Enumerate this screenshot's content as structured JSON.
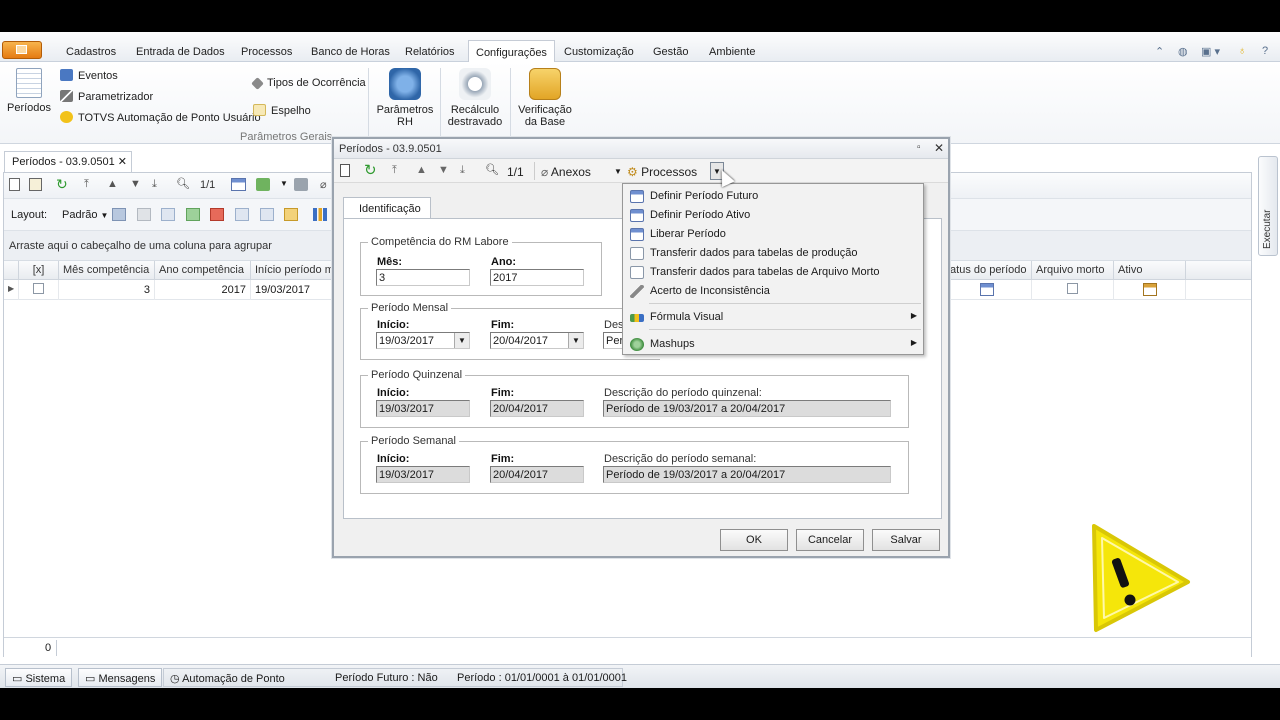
{
  "menubar": {
    "items": [
      "Cadastros",
      "Entrada de Dados",
      "Processos",
      "Banco de Horas",
      "Relatórios",
      "Configurações",
      "Customização",
      "Gestão",
      "Ambiente"
    ],
    "active": "Configurações"
  },
  "ribbon": {
    "periodos": "Períodos",
    "eventos": "Eventos",
    "parametrizador": "Parametrizador",
    "automacao": "TOTVS Automação de Ponto Usuário",
    "tipos_ocorrencia": "Tipos de Ocorrência",
    "espelho": "Espelho",
    "group_label": "Parâmetros Gerais",
    "parametros_rh_1": "Parâmetros",
    "parametros_rh_2": "RH",
    "recalculo_1": "Recálculo",
    "recalculo_2": "destravado",
    "verificacao_1": "Verificação",
    "verificacao_2": "da Base"
  },
  "doc_tab": {
    "title": "Períodos - 03.9.0501",
    "close": "✕"
  },
  "toolbar": {
    "page": "1/1"
  },
  "layoutbar": {
    "layout_label": "Layout:",
    "layout_value": "Padrão"
  },
  "groupbar": {
    "text": "Arraste aqui o cabeçalho de uma coluna para agrupar"
  },
  "grid": {
    "headers": {
      "select": "[x]",
      "mes": "Mês competência",
      "ano": "Ano competência",
      "inicio": "Início período men",
      "status": "tatus do período",
      "arquivo": "Arquivo morto",
      "ativo": "Ativo"
    },
    "row": {
      "mes": "3",
      "ano": "2017",
      "inicio": "19/03/2017"
    },
    "footer_count": "0"
  },
  "executar": "Executar",
  "statusbar": {
    "sistema": "Sistema",
    "mensagens": "Mensagens",
    "automacao": "Automação de Ponto",
    "periodo_futuro": "Período Futuro : Não",
    "periodo": "Período : 01/01/0001 à 01/01/0001"
  },
  "dialog": {
    "title": "Períodos - 03.9.0501",
    "page": "1/1",
    "anexos": "Anexos",
    "processos": "Processos",
    "tab": "Identificação",
    "competencia": {
      "legend": "Competência do RM Labore",
      "mes_label": "Mês:",
      "mes_value": "3",
      "ano_label": "Ano:",
      "ano_value": "2017"
    },
    "mensal": {
      "legend": "Período Mensal",
      "inicio_label": "Início:",
      "inicio_value": "19/03/2017",
      "fim_label": "Fim:",
      "fim_value": "20/04/2017",
      "desc_label": "Desc",
      "desc_value": "Perí"
    },
    "quinzenal": {
      "legend": "Período Quinzenal",
      "inicio_label": "Início:",
      "inicio_value": "19/03/2017",
      "fim_label": "Fim:",
      "fim_value": "20/04/2017",
      "desc_label": "Descrição do período quinzenal:",
      "desc_value": "Período de 19/03/2017 a 20/04/2017"
    },
    "semanal": {
      "legend": "Período Semanal",
      "inicio_label": "Início:",
      "inicio_value": "19/03/2017",
      "fim_label": "Fim:",
      "fim_value": "20/04/2017",
      "desc_label": "Descrição do período semanal:",
      "desc_value": "Período de 19/03/2017 a 20/04/2017"
    },
    "buttons": {
      "ok": "OK",
      "cancelar": "Cancelar",
      "salvar": "Salvar"
    }
  },
  "popup_menu": {
    "items": [
      "Definir Período Futuro",
      "Definir Período Ativo",
      "Liberar Período",
      "Transferir dados para tabelas de produção",
      "Transferir dados para tabelas de Arquivo Morto",
      "Acerto de Inconsistência",
      "Fórmula Visual",
      "Mashups"
    ]
  },
  "colors": {
    "accent": "#e57b12",
    "ribbon_bg": "#f3f5f8",
    "readonly_field": "#dcdcdc",
    "warning_yellow": "#f5e60a"
  }
}
